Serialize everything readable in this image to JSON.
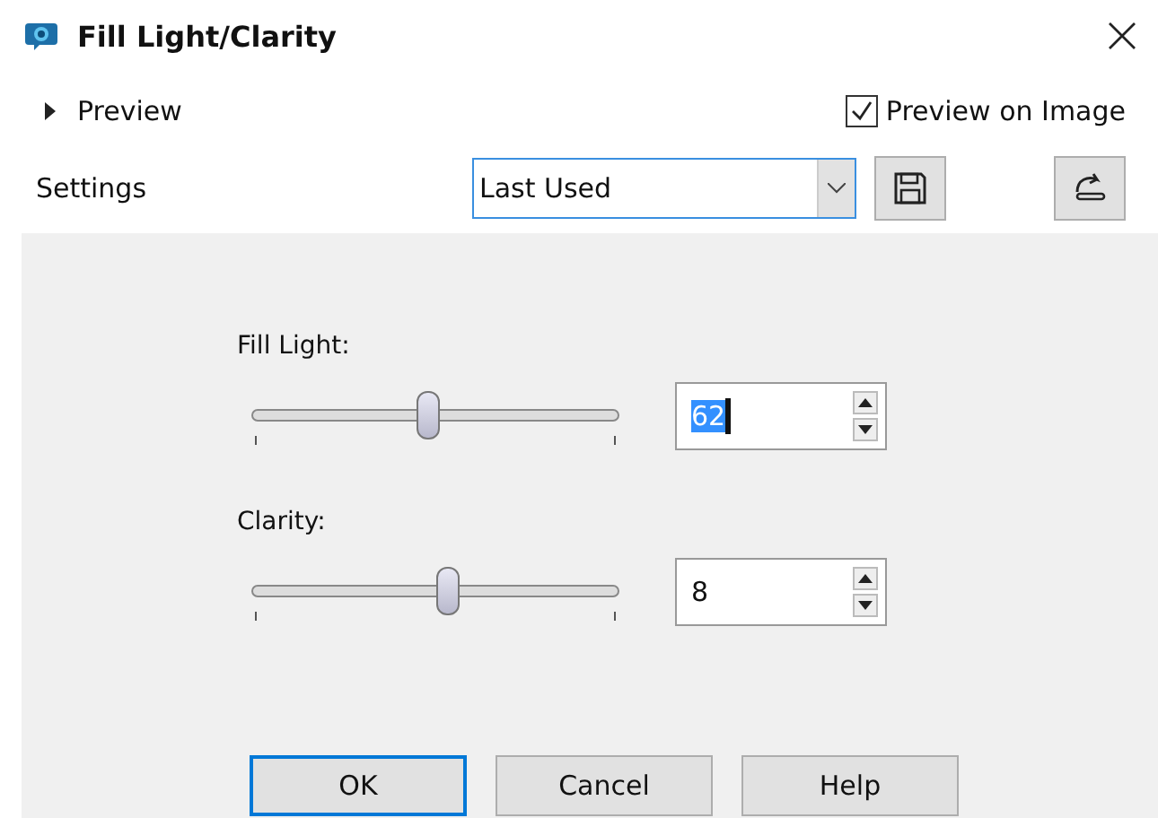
{
  "window": {
    "title": "Fill Light/Clarity"
  },
  "preview": {
    "label": "Preview",
    "expanded": false
  },
  "preview_on_image": {
    "label": "Preview on Image",
    "checked": true
  },
  "settings": {
    "label": "Settings",
    "value": "Last Used"
  },
  "controls": [
    {
      "label": "Fill Light:",
      "level": 0.48,
      "value": "62",
      "text_selected": true
    },
    {
      "label": "Clarity:",
      "level": 0.53,
      "value": "8",
      "text_selected": false
    }
  ],
  "buttons": [
    {
      "label": "OK",
      "default": true
    },
    {
      "label": "Cancel",
      "default": false
    },
    {
      "label": "Help",
      "default": false
    }
  ]
}
